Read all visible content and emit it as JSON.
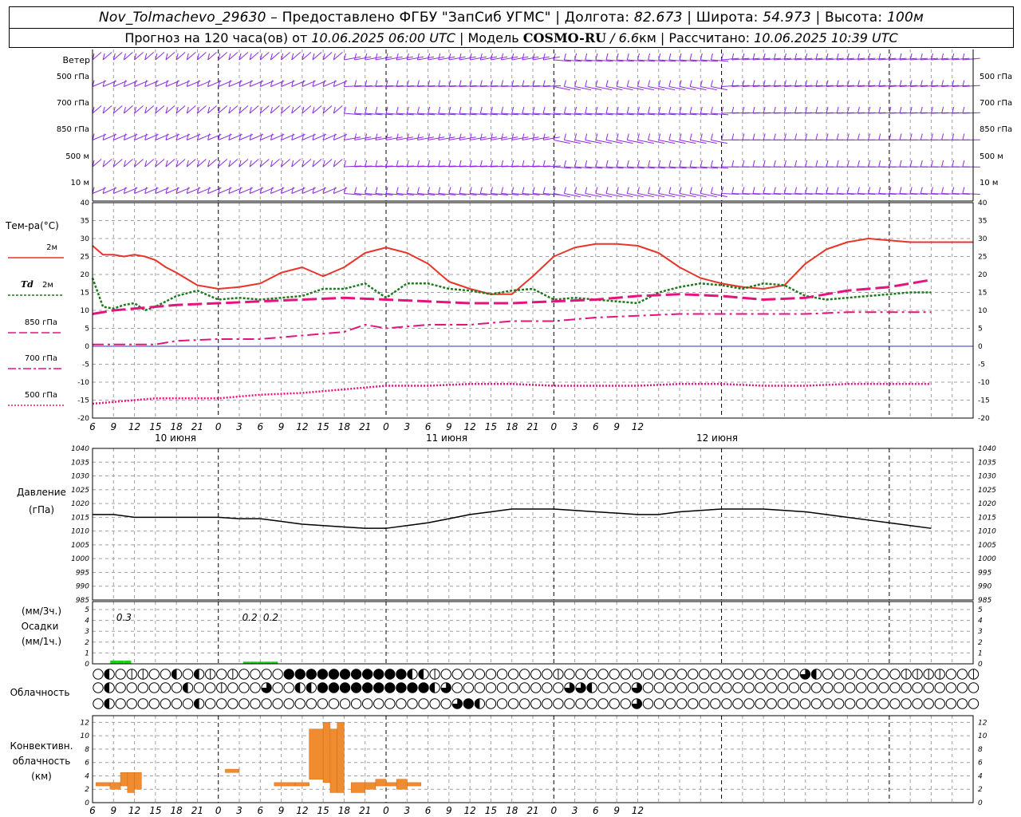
{
  "header": {
    "station": "Nov_Tolmachevo_29630",
    "provider": " – Предоставлено ФГБУ \"ЗапСиб УГМС\" | Долгота: ",
    "lon": "82.673",
    "lat_label": " | Широта: ",
    "lat": "54.973",
    "alt_label": " | Высота: ",
    "alt": "100м",
    "forecast_label": "Прогноз на 120 часа(ов) от ",
    "forecast_from": "10.06.2025 06:00 UTC",
    "model_label": "  | Модель ",
    "model": "COSMO-RU",
    "resolution": " / 6.6",
    "resolution_unit": "км",
    "calc_label": " | Рассчитано: ",
    "calculated": "10.06.2025 10:39 UTC"
  },
  "x_axis": {
    "hour_ticks": [
      "6",
      "9",
      "12",
      "15",
      "18",
      "21",
      "0",
      "3",
      "6",
      "9",
      "12",
      "15",
      "18",
      "21",
      "0",
      "3",
      "6",
      "9",
      "12",
      "15",
      "18",
      "21",
      "0",
      "3",
      "6",
      "9",
      "12"
    ],
    "day_labels": [
      "10 июня",
      "11 июня",
      "12 июня"
    ]
  },
  "wind_panel": {
    "title": "Ветер",
    "levels": [
      "500 гПа",
      "700 гПа",
      "850 гПа",
      "500 м",
      "10 м"
    ]
  },
  "temp_panel": {
    "title": "Тем-ра(°C)",
    "yticks": [
      "40",
      "35",
      "30",
      "25",
      "20",
      "15",
      "10",
      "5",
      "0",
      "-5",
      "-10",
      "-15",
      "-20"
    ]
  },
  "pressure_panel": {
    "title": "Давление",
    "unit": "(гПа)",
    "yticks": [
      "1040",
      "1035",
      "1030",
      "1025",
      "1020",
      "1015",
      "1010",
      "1005",
      "1000",
      "995",
      "990",
      "985"
    ]
  },
  "precip_panel": {
    "unit_top": "(мм/3ч.)",
    "title": "Осадки",
    "unit_bottom": "(мм/1ч.)",
    "yticks": [
      "5",
      "4",
      "3",
      "2",
      "1",
      "0"
    ],
    "labels": [
      {
        "t": 4.5,
        "text": "0.3"
      },
      {
        "t": 22.5,
        "text": "0.2"
      },
      {
        "t": 25.5,
        "text": "0.2"
      }
    ]
  },
  "cloud_panel": {
    "title": "Облачность",
    "rows": [
      "0201100202101000044444444444221000000000010000000000000000000003200000001111001000000000100100000001010300320000000000000000200302000",
      "020000002001000300224444444444230000000000332000300000000000000000000000000000000000000000000000000000000000000000000000000000000000",
      "020000000200000000000000000000003420000000000000300000000000000000000000000000000000000000000000000000000000000000000000000000000000000000000000",
      "000000000000000000000000000000000000000000000000000000000000000000000000000000000000000000000000000000000000000000000000000000000000000000000000"
    ]
  },
  "conv_panel": {
    "title1": "Конвективн.",
    "title2": "облачность",
    "unit": "(км)",
    "yticks": [
      "12",
      "10",
      "8",
      "6",
      "4",
      "2",
      "0"
    ]
  },
  "colors": {
    "t2m": "#e8352b",
    "td2m": "#1c7a1c",
    "t850": "#e6137e",
    "t700": "#e6137e",
    "t500": "#e6137e",
    "wind": "#8a2be2",
    "pressure": "#000000",
    "precip": "#19d119",
    "convective": "#f08c30",
    "zero_line": "#3030c0",
    "grid": "#a0a0a0"
  },
  "chart_data": [
    {
      "type": "line",
      "title": "Тем-ра(°C)",
      "x_unit": "hours since 10.06.2025 06:00 UTC",
      "ylim": [
        -20,
        40
      ],
      "series": [
        {
          "name": "2м",
          "x": [
            0,
            1.5,
            3,
            4.5,
            6,
            7.5,
            9,
            10.5,
            12,
            15,
            18,
            21,
            24,
            27,
            30,
            33,
            36,
            39,
            42,
            45,
            48,
            51,
            54,
            57,
            60,
            63,
            66,
            69,
            72,
            75,
            78,
            81,
            84,
            87,
            90,
            93,
            96,
            99,
            102,
            105,
            108,
            111,
            114,
            117,
            120,
            123,
            126
          ],
          "values": [
            28,
            25.5,
            25.5,
            25,
            25.5,
            25,
            24,
            22,
            20.5,
            17,
            16,
            16.5,
            17.5,
            20.5,
            22,
            19.5,
            22,
            26,
            27.5,
            26,
            23,
            18,
            16,
            14.5,
            14.5,
            19.5,
            25,
            27.5,
            28.5,
            28.5,
            28,
            26,
            22,
            19,
            17.5,
            16.5,
            16,
            17,
            23,
            27,
            29,
            30,
            29.5,
            29,
            29,
            29,
            29
          ]
        },
        {
          "name": "Td 2м",
          "x": [
            0,
            1.5,
            3,
            4.5,
            6,
            7.5,
            9,
            10.5,
            12,
            15,
            18,
            21,
            24,
            27,
            30,
            33,
            36,
            39,
            42,
            45,
            48,
            51,
            54,
            57,
            60,
            63,
            66,
            69,
            72,
            75,
            78,
            81,
            84,
            87,
            90,
            93,
            96,
            99,
            102,
            105,
            108,
            111,
            114,
            117,
            120
          ],
          "values": [
            19,
            11,
            10.5,
            11.5,
            12,
            10,
            11,
            12.5,
            14,
            15.5,
            13,
            13.5,
            13,
            13.5,
            14,
            16,
            16,
            17.5,
            13.5,
            17.5,
            17.5,
            16,
            15.5,
            14.5,
            15.5,
            16,
            13,
            13.5,
            13,
            12.5,
            12,
            15,
            16.5,
            17.5,
            17,
            16,
            17.5,
            17,
            14,
            13,
            13.5,
            14,
            14.5,
            15,
            15
          ]
        },
        {
          "name": "850 гПа",
          "x": [
            0,
            3,
            6,
            9,
            12,
            18,
            24,
            30,
            36,
            42,
            48,
            54,
            60,
            66,
            72,
            78,
            84,
            90,
            96,
            102,
            108,
            114,
            120
          ],
          "values": [
            9,
            10,
            10.5,
            11,
            11.5,
            12,
            12.5,
            13,
            13.5,
            13,
            12.5,
            12,
            12,
            12.5,
            13,
            14,
            14.5,
            14,
            13,
            13.5,
            15.5,
            16.5,
            18.5
          ]
        },
        {
          "name": "700 гПа",
          "x": [
            0,
            6,
            9,
            12,
            18,
            24,
            30,
            36,
            39,
            42,
            48,
            54,
            60,
            66,
            72,
            78,
            84,
            90,
            96,
            102,
            108,
            114,
            120
          ],
          "values": [
            0.5,
            0.5,
            0.5,
            1.5,
            2,
            2,
            3,
            4,
            6,
            5,
            6,
            6,
            7,
            7,
            8,
            8.5,
            9,
            9,
            9,
            9,
            9.5,
            9.5,
            9.5
          ]
        },
        {
          "name": "500 гПа",
          "x": [
            0,
            6,
            9,
            12,
            18,
            24,
            30,
            36,
            42,
            48,
            54,
            60,
            66,
            72,
            78,
            84,
            90,
            96,
            102,
            108,
            114,
            120
          ],
          "values": [
            -16,
            -15,
            -14.5,
            -14.5,
            -14.5,
            -13.5,
            -13,
            -12,
            -11,
            -11,
            -10.5,
            -10.5,
            -11,
            -11,
            -11,
            -10.5,
            -10.5,
            -11,
            -11,
            -10.5,
            -10.5,
            -10.5
          ]
        }
      ]
    },
    {
      "type": "line",
      "title": "Давление",
      "ylabel": "(гПа)",
      "ylim": [
        985,
        1040
      ],
      "series": [
        {
          "name": "",
          "x": [
            0,
            3,
            6,
            9,
            12,
            15,
            18,
            21,
            24,
            27,
            30,
            33,
            36,
            39,
            42,
            45,
            48,
            51,
            54,
            57,
            60,
            63,
            66,
            69,
            72,
            75,
            78,
            81,
            84,
            87,
            90,
            93,
            96,
            99,
            102,
            105,
            108,
            111,
            114,
            117,
            120
          ],
          "values": [
            1016,
            1016,
            1015,
            1015,
            1015,
            1015,
            1015,
            1014.5,
            1014.5,
            1013.5,
            1012.5,
            1012,
            1011.5,
            1011,
            1011,
            1012,
            1013,
            1014.5,
            1016,
            1017,
            1018,
            1018,
            1018,
            1017.5,
            1017,
            1016.5,
            1016,
            1016,
            1017,
            1017.5,
            1018,
            1018,
            1018,
            1017.5,
            1017,
            1016,
            1015,
            1014,
            1013,
            1012,
            1011
          ]
        }
      ]
    },
    {
      "type": "bar",
      "title": "Осадки",
      "ylabel": "(мм/3ч.) (мм/1ч.)",
      "ylim": [
        0,
        5
      ],
      "series": [
        {
          "name": "",
          "x": [
            3,
            4,
            5,
            22,
            23,
            24,
            25,
            26
          ],
          "values": [
            0.3,
            0.3,
            0.3,
            0.2,
            0.2,
            0.2,
            0.2,
            0.2
          ]
        }
      ]
    },
    {
      "type": "bar",
      "title": "Конвективн. облачность",
      "ylabel": "(км)",
      "ylim": [
        0,
        13
      ],
      "bars": [
        {
          "x0": 0.5,
          "x1": 2.5,
          "bottom": 2.5,
          "top": 3
        },
        {
          "x0": 2.5,
          "x1": 4,
          "bottom": 2,
          "top": 3
        },
        {
          "x0": 4,
          "x1": 5,
          "bottom": 2.5,
          "top": 4.5
        },
        {
          "x0": 5,
          "x1": 6,
          "bottom": 1.5,
          "top": 4.5
        },
        {
          "x0": 6,
          "x1": 7,
          "bottom": 2,
          "top": 4.5
        },
        {
          "x0": 19,
          "x1": 21,
          "bottom": 4.5,
          "top": 5
        },
        {
          "x0": 26,
          "x1": 29,
          "bottom": 2.5,
          "top": 3
        },
        {
          "x0": 29,
          "x1": 31,
          "bottom": 2.5,
          "top": 3
        },
        {
          "x0": 31,
          "x1": 33,
          "bottom": 3.5,
          "top": 11
        },
        {
          "x0": 33,
          "x1": 34,
          "bottom": 3,
          "top": 12
        },
        {
          "x0": 34,
          "x1": 35,
          "bottom": 1.5,
          "top": 11
        },
        {
          "x0": 35,
          "x1": 36,
          "bottom": 1.5,
          "top": 12
        },
        {
          "x0": 37,
          "x1": 39,
          "bottom": 1.5,
          "top": 3
        },
        {
          "x0": 39,
          "x1": 40.5,
          "bottom": 2,
          "top": 3
        },
        {
          "x0": 40.5,
          "x1": 42,
          "bottom": 2.5,
          "top": 3.5
        },
        {
          "x0": 42,
          "x1": 43.5,
          "bottom": 2.5,
          "top": 3
        },
        {
          "x0": 43.5,
          "x1": 45,
          "bottom": 2,
          "top": 3.5
        },
        {
          "x0": 45,
          "x1": 47,
          "bottom": 2.5,
          "top": 3
        }
      ]
    }
  ]
}
